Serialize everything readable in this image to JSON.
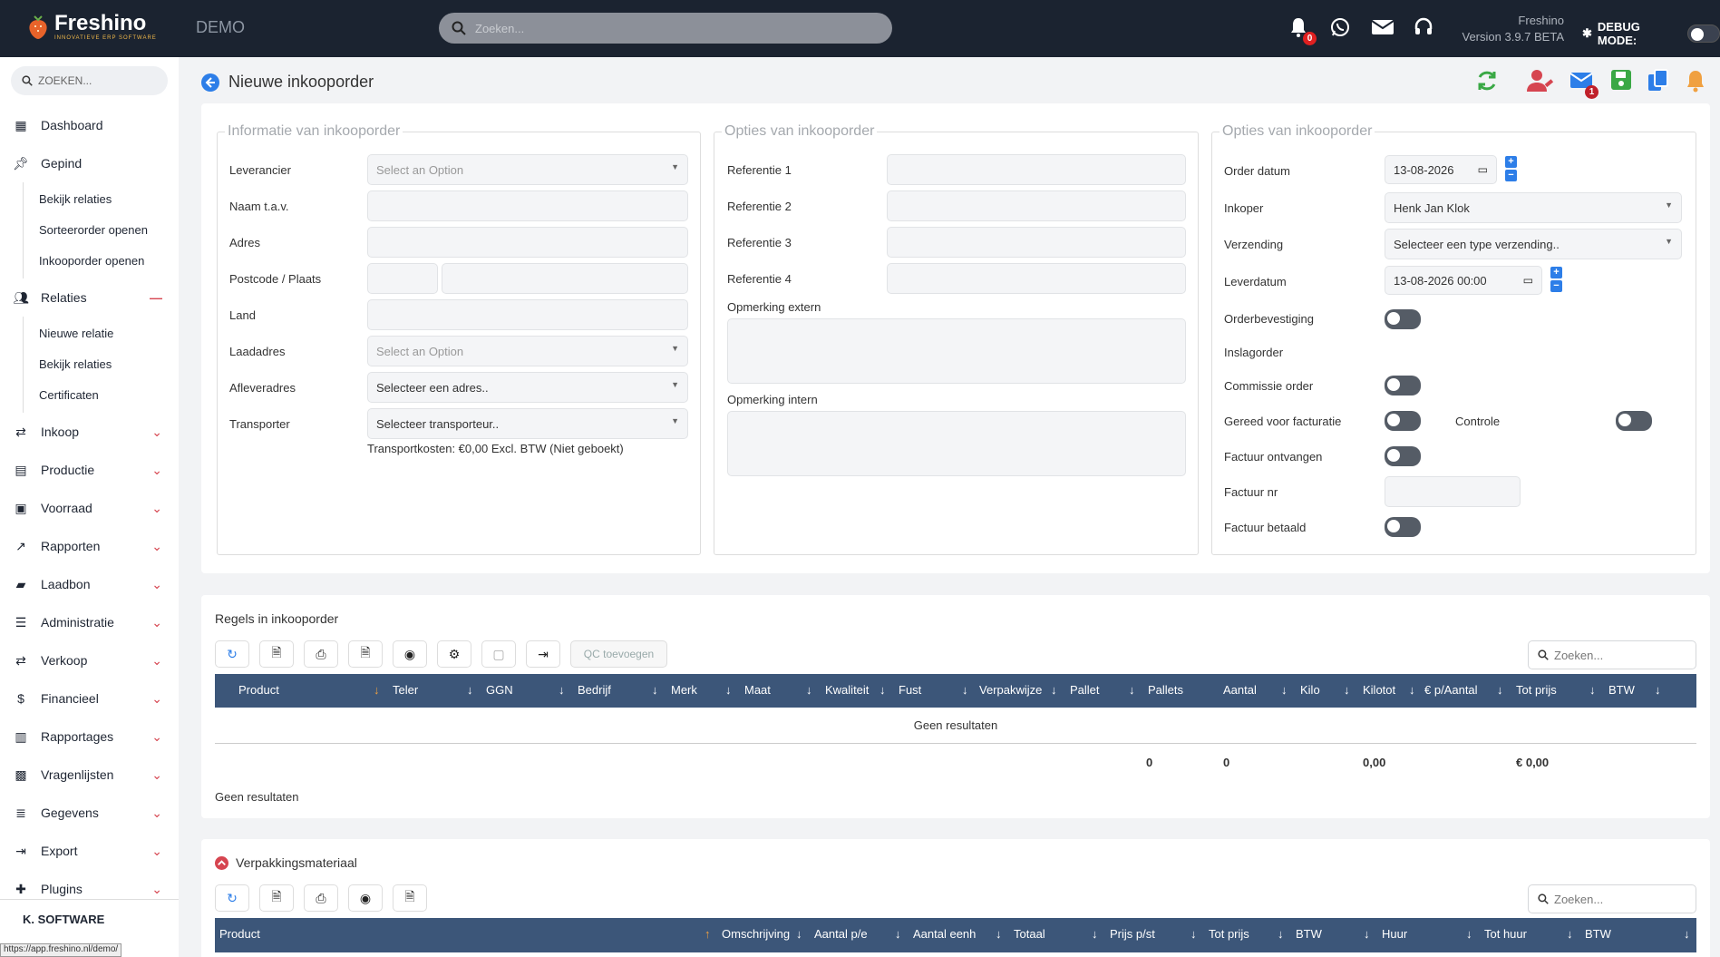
{
  "topbar": {
    "logo_name": "Freshino",
    "logo_sub": "INNOVATIEVE ERP SOFTWARE",
    "env": "DEMO",
    "search_placeholder": "Zoeken...",
    "notif_count": "0",
    "version_line1": "Freshino",
    "version_line2": "Version 3.9.7 BETA",
    "debug_label": "DEBUG MODE:"
  },
  "sidebar": {
    "search": "ZOEKEN...",
    "dashboard": "Dashboard",
    "gepind": "Gepind",
    "gepind_items": [
      "Bekijk relaties",
      "Sorteerorder openen",
      "Inkooporder openen"
    ],
    "relaties": "Relaties",
    "relaties_items": [
      "Nieuwe relatie",
      "Bekijk relaties",
      "Certificaten"
    ],
    "menu": [
      "Inkoop",
      "Productie",
      "Voorraad",
      "Rapporten",
      "Laadbon",
      "Administratie",
      "Verkoop",
      "Financieel",
      "Rapportages",
      "Vragenlijsten",
      "Gegevens",
      "Export",
      "Plugins"
    ],
    "footer": "K. SOFTWARE",
    "status_url": "https://app.freshino.nl/demo/"
  },
  "page": {
    "title": "Nieuwe inkooporder",
    "mail_badge": "1"
  },
  "info": {
    "legend": "Informatie van inkooporder",
    "leverancier": "Leverancier",
    "naam": "Naam t.a.v.",
    "adres": "Adres",
    "postcode": "Postcode / Plaats",
    "land": "Land",
    "laadadres": "Laadadres",
    "afleveradres": "Afleveradres",
    "transporter": "Transporter",
    "select_option": "Select an Option",
    "afleveradres_val": "Selecteer een adres..",
    "transporter_val": "Selecteer transporteur..",
    "transportkosten": "Transportkosten: €0,00 Excl. BTW (Niet geboekt)"
  },
  "opties1": {
    "legend": "Opties van inkooporder",
    "ref1": "Referentie 1",
    "ref2": "Referentie 2",
    "ref3": "Referentie 3",
    "ref4": "Referentie 4",
    "opm_extern": "Opmerking extern",
    "opm_intern": "Opmerking intern"
  },
  "opties2": {
    "legend": "Opties van inkooporder",
    "orderdatum": "Order datum",
    "orderdatum_val": "13-08-2026",
    "inkoper": "Inkoper",
    "inkoper_val": "Henk Jan Klok",
    "verzending": "Verzending",
    "verzending_val": "Selecteer een type verzending..",
    "leverdatum": "Leverdatum",
    "leverdatum_val": "13-08-2026 00:00",
    "orderbevestiging": "Orderbevestiging",
    "inslagorder": "Inslagorder",
    "commissie": "Commissie order",
    "gereed": "Gereed voor facturatie",
    "controle": "Controle",
    "factuur_ontvangen": "Factuur ontvangen",
    "factuur_nr": "Factuur nr",
    "factuur_betaald": "Factuur betaald"
  },
  "regels": {
    "title": "Regels in inkooporder",
    "qc": "QC toevoegen",
    "search": "Zoeken...",
    "columns": [
      "Product",
      "Teler",
      "GGN",
      "Bedrijf",
      "Merk",
      "Maat",
      "Kwaliteit",
      "Fust",
      "Verpakwijze",
      "Pallet",
      "Pallets",
      "Aantal",
      "Kilo",
      "Kilotot",
      "€ p/Aantal",
      "Tot prijs",
      "BTW"
    ],
    "empty": "Geen resultaten",
    "tot_pallets": "0",
    "tot_aantal": "0",
    "tot_kilotot": "0,00",
    "tot_prijs": "€ 0,00",
    "footer": "Geen resultaten"
  },
  "verpak": {
    "title": "Verpakkingsmateriaal",
    "search": "Zoeken...",
    "columns": [
      "Product",
      "Omschrijving",
      "Aantal p/e",
      "Aantal eenh",
      "Totaal",
      "Prijs p/st",
      "Tot prijs",
      "BTW",
      "Huur",
      "Tot huur",
      "BTW"
    ]
  },
  "colors": {
    "topbar": "#1b2330",
    "table_header": "#3c5679",
    "accent_blue": "#2d7ee8",
    "green": "#3aa845",
    "red": "#d64550",
    "orange": "#f0a040"
  }
}
